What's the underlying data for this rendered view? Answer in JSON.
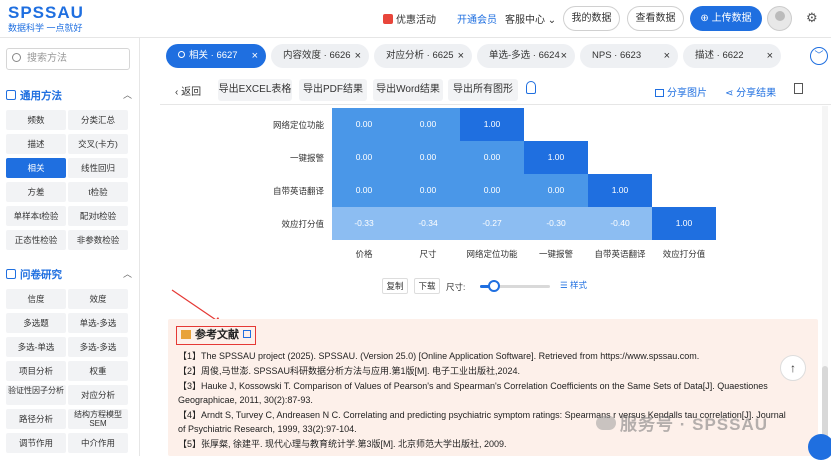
{
  "header": {
    "logo_main": "SPSSAU",
    "logo_sub": "数据科学 一点就好",
    "nav_gift": "优惠活动",
    "nav_vip": "开通会员",
    "nav_cs": "客服中心 ⌄",
    "btn_mydata": "我的数据",
    "btn_view": "查看数据",
    "btn_upload": "⊕ 上传数据"
  },
  "sidebar": {
    "search_placeholder": "搜索方法",
    "section1": "通用方法",
    "section1_items": [
      "频数",
      "分类汇总",
      "描述",
      "交叉(卡方)",
      "相关",
      "线性回归",
      "方差",
      "t检验",
      "单样本t检验",
      "配对t检验",
      "正态性检验",
      "非参数检验"
    ],
    "section2": "问卷研究",
    "section2_items": [
      "信度",
      "效度",
      "多选题",
      "单选-多选",
      "多选-单选",
      "多选-多选",
      "项目分析",
      "权重",
      "验证性因子分析",
      "对应分析",
      "路径分析",
      "结构方程模型SEM",
      "调节作用",
      "中介作用"
    ]
  },
  "tabs": [
    {
      "label": "相关 · 6627"
    },
    {
      "label": "内容效度 · 6626"
    },
    {
      "label": "对应分析 · 6625"
    },
    {
      "label": "单选-多选 · 6624"
    },
    {
      "label": "NPS · 6623"
    },
    {
      "label": "描述 · 6622"
    }
  ],
  "toolbar": {
    "back": "返回",
    "export_excel": "导出EXCEL表格",
    "export_pdf": "导出PDF结果",
    "export_word": "导出Word结果",
    "export_all": "导出所有图形",
    "share_img": "分享图片",
    "share_result": "分享结果"
  },
  "heatmap": {
    "rows": [
      "网络定位功能",
      "一键报警",
      "自带英语翻译",
      "效应打分值"
    ],
    "cols": [
      "价格",
      "尺寸",
      "网络定位功能",
      "一键报警",
      "自带英语翻译",
      "效应打分值"
    ],
    "values": [
      [
        "0.00",
        "0.00",
        "1.00",
        "",
        "",
        ""
      ],
      [
        "0.00",
        "0.00",
        "0.00",
        "1.00",
        "",
        ""
      ],
      [
        "0.00",
        "0.00",
        "0.00",
        "0.00",
        "1.00",
        ""
      ],
      [
        "-0.33",
        "-0.34",
        "-0.27",
        "-0.30",
        "-0.40",
        "1.00"
      ]
    ],
    "colors": {
      "one": "#1f6fe0",
      "zero": "#4a97e8",
      "neg": "#8cbdf2"
    }
  },
  "controls": {
    "copy": "复制",
    "download": "下载",
    "size_label": "尺寸:",
    "size_value": 0.2,
    "style": "样式"
  },
  "references": {
    "title": "参考文献",
    "items": [
      "【1】The SPSSAU project (2025). SPSSAU. (Version 25.0) [Online Application Software]. Retrieved from https://www.spssau.com.",
      "【2】周俊,马世澎. SPSSAU科研数据分析方法与应用.第1版[M]. 电子工业出版社,2024.",
      "【3】Hauke J, Kossowski T. Comparison of Values of Pearson's and Spearman's Correlation Coefficients on the Same Sets of Data[J]. Quaestiones",
      "Geographicae, 2011, 30(2):87-93.",
      "【4】Arndt S, Turvey C, Andreasen N C. Correlating and predicting psychiatric symptom ratings: Spearmans r versus Kendalls tau correlation[J]. Journal",
      "of Psychiatric Research, 1999, 33(2):97-104.",
      "【5】张厚粲, 徐建平. 现代心理与教育统计学.第3版[M]. 北京师范大学出版社, 2009."
    ]
  },
  "watermark": "服务号 · SPSSAU"
}
